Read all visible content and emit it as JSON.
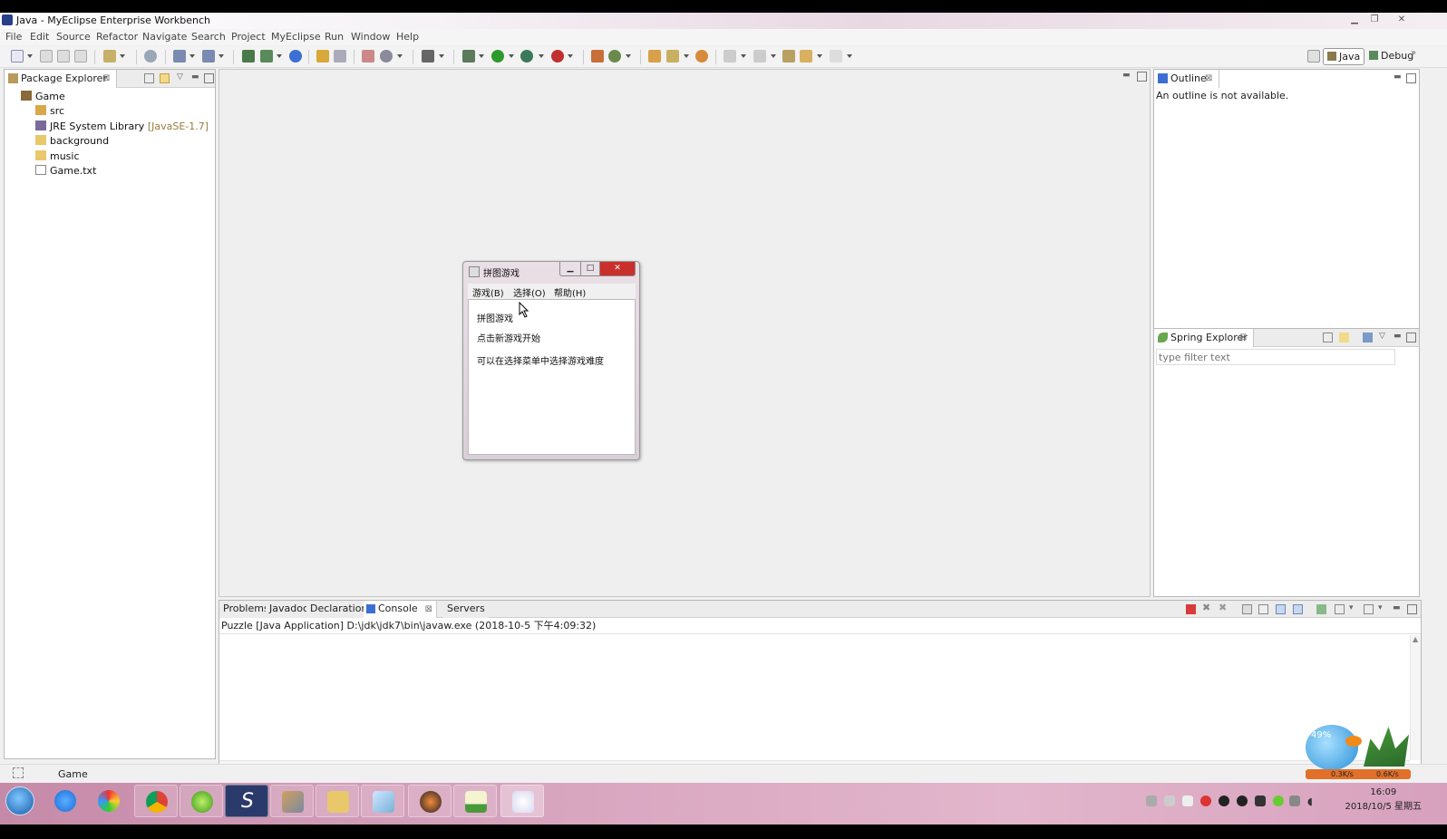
{
  "window": {
    "title": "Java - MyEclipse Enterprise Workbench"
  },
  "menubar": [
    "File",
    "Edit",
    "Source",
    "Refactor",
    "Navigate",
    "Search",
    "Project",
    "MyEclipse",
    "Run",
    "Window",
    "Help"
  ],
  "perspectives": {
    "java": "Java",
    "debug": "Debug"
  },
  "package_explorer": {
    "tab": "Package Explorer",
    "tree": [
      {
        "label": "Game",
        "decoration": ""
      },
      {
        "label": "src",
        "decoration": ""
      },
      {
        "label": "JRE System Library",
        "decoration": "[JavaSE-1.7]"
      },
      {
        "label": "background",
        "decoration": ""
      },
      {
        "label": "music",
        "decoration": ""
      },
      {
        "label": "Game.txt",
        "decoration": ""
      }
    ]
  },
  "outline": {
    "tab": "Outline",
    "message": "An outline is not available."
  },
  "spring_explorer": {
    "tab": "Spring Explorer",
    "filter_placeholder": "type filter text"
  },
  "dialog": {
    "title": "拼图游戏",
    "menus": [
      "游戏(B)",
      "选择(O)",
      "帮助(H)"
    ],
    "lines": [
      "拼图游戏",
      "点击新游戏开始",
      "可以在选择菜单中选择游戏难度"
    ]
  },
  "bottom_panel": {
    "tabs": [
      "Problems",
      "Javadoc",
      "Declaration",
      "Console",
      "Servers"
    ],
    "active_tab": "Console",
    "console_header": "Puzzle [Java Application] D:\\jdk\\jdk7\\bin\\javaw.exe (2018-10-5 下午4:09:32)"
  },
  "statusbar": {
    "text": "Game"
  },
  "taskbar": {
    "apps": [
      "windows-start",
      "internet-explorer",
      "color-app",
      "chrome",
      "green-app",
      "s-app",
      "tools-app",
      "folder",
      "notepad",
      "penguin-app",
      "chart-app",
      "java-app"
    ],
    "clock_time": "16:09",
    "clock_date": "2018/10/5 星期五",
    "net_widget": {
      "percent": "49%",
      "up": "0.3K/s",
      "down": "0.6K/s"
    }
  },
  "colors": {
    "accent": "#3b6fd4",
    "taskbar": "#d9a6c0",
    "close_red": "#c9302c"
  }
}
